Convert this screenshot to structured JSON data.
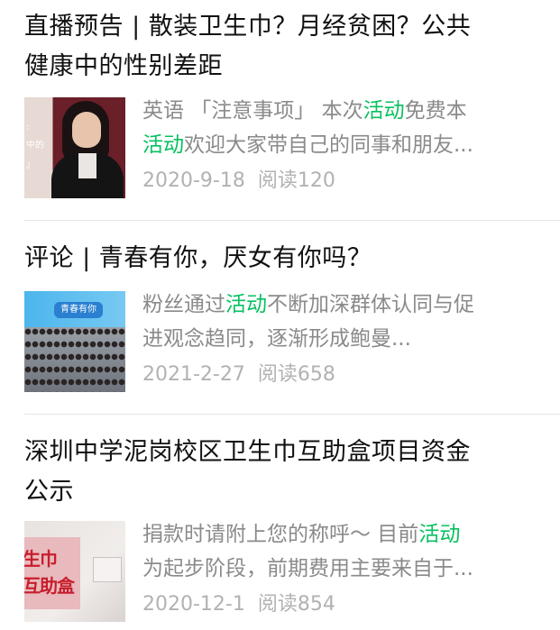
{
  "articles": [
    {
      "title_lines": [
        "直播预告 | 散装卫生巾？月经贫困？公共",
        "健康中的性别差距"
      ],
      "summary": {
        "line1": [
          {
            "text": "英语 「注意事项」 本次",
            "highlight": false
          },
          {
            "text": "活动",
            "highlight": true
          },
          {
            "text": "免费本",
            "highlight": false
          }
        ],
        "line2": [
          {
            "text": "活动",
            "highlight": true
          },
          {
            "text": "欢迎大家带自己的同事和朋友...",
            "highlight": false
          }
        ]
      },
      "date": "2020-9-18",
      "reads": "阅读120",
      "thumb_text": [
        ":",
        "中的",
        "』"
      ]
    },
    {
      "title_lines": [
        "评论 | 青春有你，厌女有你吗？"
      ],
      "summary": {
        "line1": [
          {
            "text": "粉丝通过",
            "highlight": false
          },
          {
            "text": "活动",
            "highlight": true
          },
          {
            "text": "不断加深群体认同与促",
            "highlight": false
          }
        ],
        "line2": [
          {
            "text": "进观念趋同，逐渐形成鲍曼...",
            "highlight": false
          }
        ]
      },
      "date": "2021-2-27",
      "reads": "阅读658",
      "thumb_text": [
        "青春有你"
      ]
    },
    {
      "title_lines": [
        "深圳中学泥岗校区卫生巾互助盒项目资金",
        "公示"
      ],
      "summary": {
        "line1": [
          {
            "text": "捐款时请附上您的称呼～ 目前",
            "highlight": false
          },
          {
            "text": "活动",
            "highlight": true
          }
        ],
        "line2": [
          {
            "text": "为起步阶段，前期费用主要来自于...",
            "highlight": false
          }
        ]
      },
      "date": "2020-12-1",
      "reads": "阅读854",
      "thumb_text": [
        "生巾",
        "互助盒"
      ]
    }
  ],
  "colors": {
    "highlight": "#07c160",
    "title": "#111111",
    "summary": "#8a8a8a",
    "meta": "#b2b2b2",
    "divider": "#e5e5e5"
  }
}
